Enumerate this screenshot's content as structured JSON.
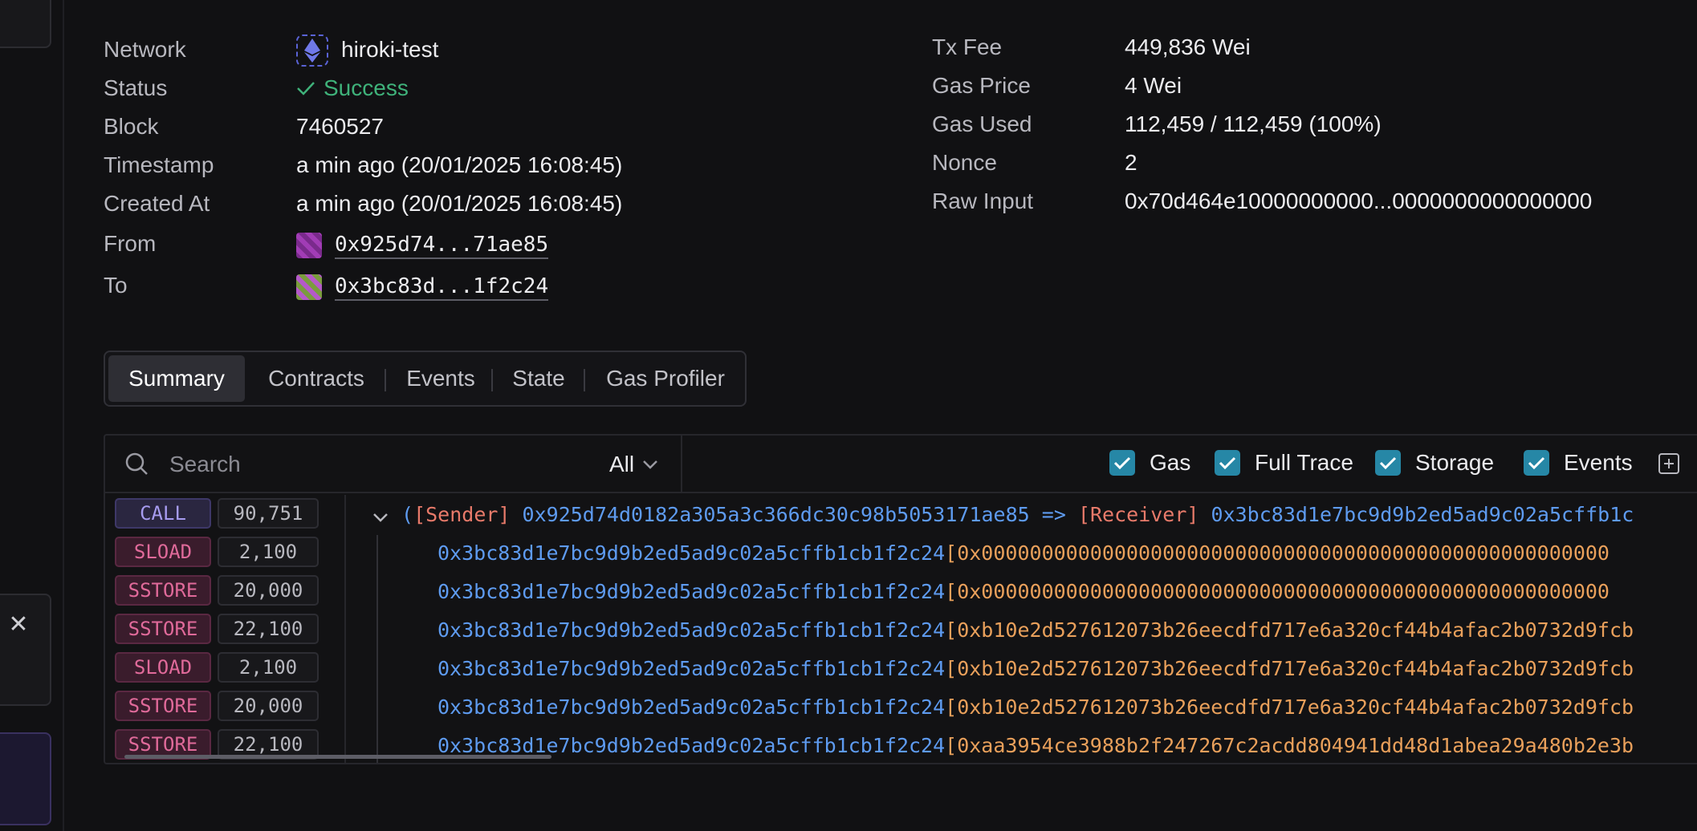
{
  "details_left": [
    {
      "label": "Network",
      "value": "hiroki-test"
    },
    {
      "label": "Status",
      "value": "Success"
    },
    {
      "label": "Block",
      "value": "7460527"
    },
    {
      "label": "Timestamp",
      "value": "a min ago (20/01/2025 16:08:45)"
    },
    {
      "label": "Created At",
      "value": "a min ago (20/01/2025 16:08:45)"
    },
    {
      "label": "From",
      "value": "0x925d74...71ae85"
    },
    {
      "label": "To",
      "value": "0x3bc83d...1f2c24"
    }
  ],
  "details_right": [
    {
      "label": "Tx Fee",
      "value": "449,836 Wei"
    },
    {
      "label": "Gas Price",
      "value": "4 Wei"
    },
    {
      "label": "Gas Used",
      "value": "112,459 / 112,459 (100%)"
    },
    {
      "label": "Nonce",
      "value": "2"
    },
    {
      "label": "Raw Input",
      "value": "0x70d464e10000000000...0000000000000000"
    }
  ],
  "status_icon": "check-icon",
  "network_icon": "ethereum-icon",
  "tabs": [
    {
      "label": "Summary",
      "active": true
    },
    {
      "label": "Contracts"
    },
    {
      "label": "Events"
    },
    {
      "label": "State"
    },
    {
      "label": "Gas Profiler"
    }
  ],
  "search": {
    "placeholder": "Search",
    "filter": "All"
  },
  "toggles": [
    {
      "label": "Gas",
      "checked": true
    },
    {
      "label": "Full Trace",
      "checked": true
    },
    {
      "label": "Storage",
      "checked": true
    },
    {
      "label": "Events",
      "checked": true
    }
  ],
  "call": {
    "op": "CALL",
    "gas": "90,751",
    "open_paren": "(",
    "sender_tag": "[Sender]",
    "sender": "0x925d74d0182a305a3c366dc30c98b5053171ae85",
    "arrow": "=>",
    "receiver_tag": "[Receiver]",
    "receiver": "0x3bc83d1e7bc9d9b2ed5ad9c02a5cffb1c"
  },
  "rows": [
    {
      "op": "SLOAD",
      "gas": "2,100",
      "contract": "0x3bc83d1e7bc9d9b2ed5ad9c02a5cffb1cb1f2c24",
      "slot": "[0x0000000000000000000000000000000000000000000000000000"
    },
    {
      "op": "SSTORE",
      "gas": "20,000",
      "contract": "0x3bc83d1e7bc9d9b2ed5ad9c02a5cffb1cb1f2c24",
      "slot": "[0x0000000000000000000000000000000000000000000000000000"
    },
    {
      "op": "SSTORE",
      "gas": "22,100",
      "contract": "0x3bc83d1e7bc9d9b2ed5ad9c02a5cffb1cb1f2c24",
      "slot": "[0xb10e2d527612073b26eecdfd717e6a320cf44b4afac2b0732d9fcb"
    },
    {
      "op": "SLOAD",
      "gas": "2,100",
      "contract": "0x3bc83d1e7bc9d9b2ed5ad9c02a5cffb1cb1f2c24",
      "slot": "[0xb10e2d527612073b26eecdfd717e6a320cf44b4afac2b0732d9fcb"
    },
    {
      "op": "SSTORE",
      "gas": "20,000",
      "contract": "0x3bc83d1e7bc9d9b2ed5ad9c02a5cffb1cb1f2c24",
      "slot": "[0xb10e2d527612073b26eecdfd717e6a320cf44b4afac2b0732d9fcb"
    },
    {
      "op": "SSTORE",
      "gas": "22,100",
      "contract": "0x3bc83d1e7bc9d9b2ed5ad9c02a5cffb1cb1f2c24",
      "slot": "[0xaa3954ce3988b2f247267c2acdd804941dd48d1abea29a480b2e3b"
    }
  ]
}
